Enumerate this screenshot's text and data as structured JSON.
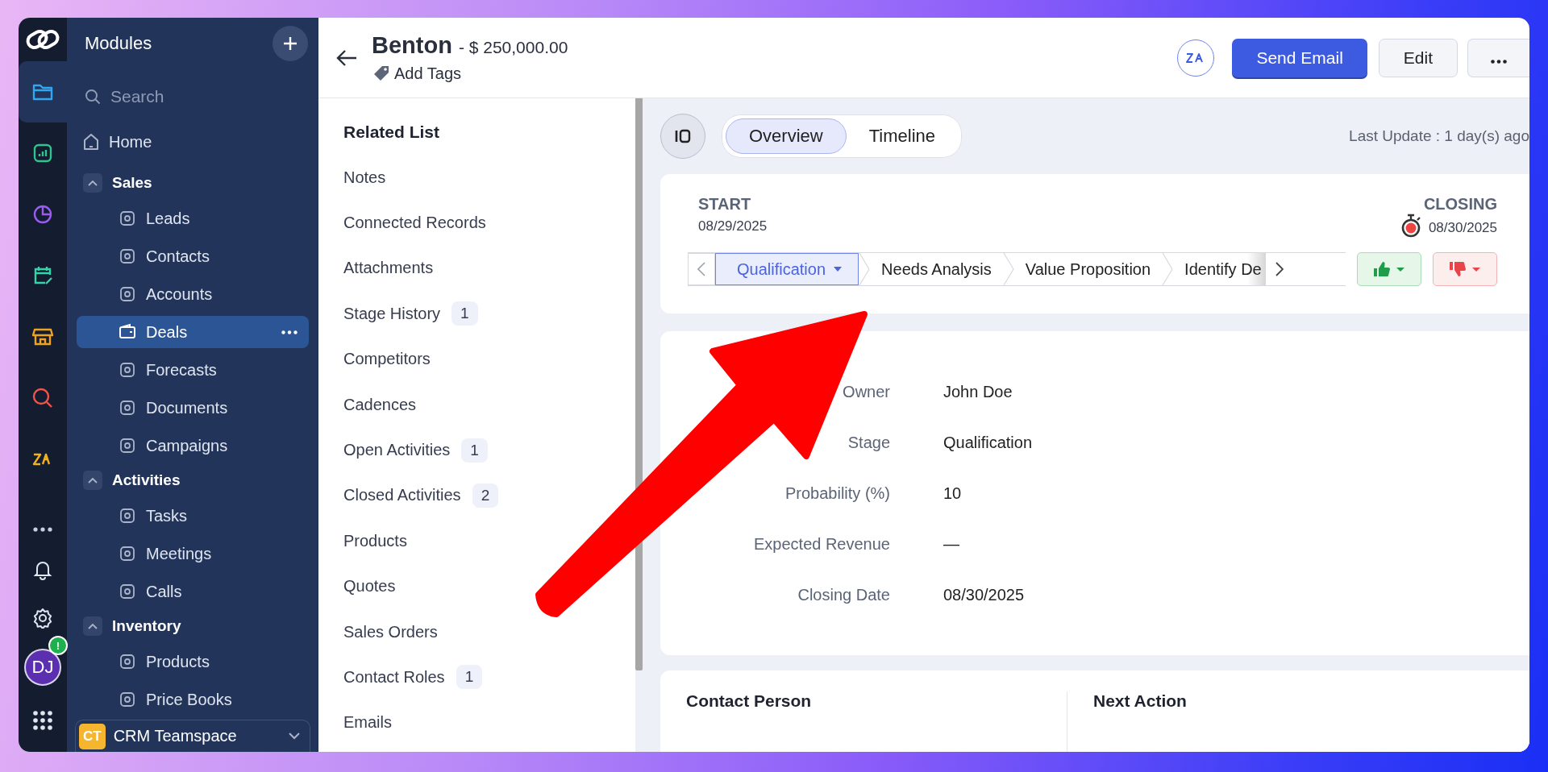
{
  "rail": [
    {
      "selected": true
    },
    {
      "selected": false
    },
    {
      "selected": false
    },
    {
      "selected": false
    },
    {
      "selected": false
    },
    {
      "selected": false
    },
    {
      "selected": false
    }
  ],
  "user": {
    "initials": "DJ",
    "alert": "!"
  },
  "modules": {
    "title": "Modules",
    "search": {
      "placeholder": "Search"
    },
    "nav": [
      {
        "kind": "item",
        "label": "Home",
        "selected": false
      },
      {
        "kind": "group",
        "label": "Sales",
        "expanded": true,
        "children": [
          {
            "label": "Leads",
            "selected": false
          },
          {
            "label": "Contacts",
            "selected": false
          },
          {
            "label": "Accounts",
            "selected": false
          },
          {
            "label": "Deals",
            "selected": true
          },
          {
            "label": "Forecasts",
            "selected": false
          },
          {
            "label": "Documents",
            "selected": false
          },
          {
            "label": "Campaigns",
            "selected": false
          }
        ]
      },
      {
        "kind": "group",
        "label": "Activities",
        "expanded": true,
        "children": [
          {
            "label": "Tasks",
            "selected": false
          },
          {
            "label": "Meetings",
            "selected": false
          },
          {
            "label": "Calls",
            "selected": false
          }
        ]
      },
      {
        "kind": "group",
        "label": "Inventory",
        "expanded": true,
        "children": [
          {
            "label": "Products",
            "selected": false
          },
          {
            "label": "Price Books",
            "selected": false
          }
        ]
      }
    ],
    "teamspace": {
      "badge": "CT",
      "name": "CRM Teamspace"
    }
  },
  "record": {
    "title": "Benton",
    "amount": "- $ 250,000.00",
    "add_tags": "Add Tags"
  },
  "actions": {
    "primary": "Send Email",
    "secondary": "Edit"
  },
  "related_list": {
    "title": "Related List",
    "items": [
      {
        "label": "Notes"
      },
      {
        "label": "Connected Records"
      },
      {
        "label": "Attachments"
      },
      {
        "label": "Stage History",
        "count": "1"
      },
      {
        "label": "Competitors"
      },
      {
        "label": "Cadences"
      },
      {
        "label": "Open Activities",
        "count": "1"
      },
      {
        "label": "Closed Activities",
        "count": "2"
      },
      {
        "label": "Products"
      },
      {
        "label": "Quotes"
      },
      {
        "label": "Sales Orders"
      },
      {
        "label": "Contact Roles",
        "count": "1"
      },
      {
        "label": "Emails"
      }
    ]
  },
  "tabs": [
    {
      "label": "Overview",
      "selected": true
    },
    {
      "label": "Timeline",
      "selected": false
    }
  ],
  "last_update": "Last Update : 1 day(s) ago",
  "pipeline": {
    "start_label": "START",
    "start_date": "08/29/2025",
    "closing_label": "CLOSING",
    "closing_date": "08/30/2025",
    "stages": [
      {
        "label": "Qualification",
        "selected": true
      },
      {
        "label": "Needs Analysis",
        "selected": false
      },
      {
        "label": "Value Proposition",
        "selected": false
      },
      {
        "label": "Identify De",
        "selected": false
      }
    ]
  },
  "fields": [
    {
      "label": "Owner",
      "value": "John Doe"
    },
    {
      "label": "Stage",
      "value": "Qualification"
    },
    {
      "label": "Probability (%)",
      "value": "10"
    },
    {
      "label": "Expected Revenue",
      "value": "—"
    },
    {
      "label": "Closing Date",
      "value": "08/30/2025"
    }
  ],
  "sections": [
    {
      "title": "Contact Person"
    },
    {
      "title": "Next Action"
    }
  ]
}
